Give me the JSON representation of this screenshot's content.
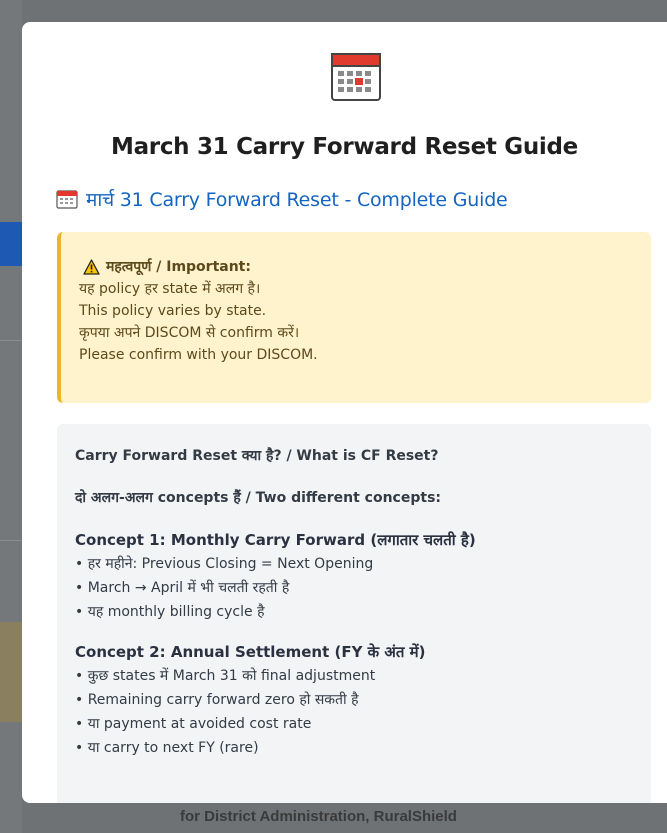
{
  "background": {
    "bottom_text": "for District Administration, RuralShield"
  },
  "modal": {
    "icon": "calendar-icon",
    "title": "March 31 Carry Forward Reset Guide",
    "guide_link": "मार्च 31 Carry Forward Reset - Complete Guide",
    "warning": {
      "icon": "warning-icon",
      "heading": "महत्वपूर्ण / Important:",
      "lines": [
        "यह policy हर state में अलग है।",
        "This policy varies by state.",
        "कृपया अपने DISCOM से confirm करें।",
        "Please confirm with your DISCOM."
      ]
    },
    "content": {
      "q1": "Carry Forward Reset क्या है? / What is CF Reset?",
      "q2": "दो अलग-अलग concepts हैं / Two different concepts:",
      "concept1": {
        "title": "Concept 1: Monthly Carry Forward (लगातार चलती है)",
        "bullets": [
          "• हर महीने: Previous Closing = Next Opening",
          "• March → April में भी चलती रहती है",
          "• यह monthly billing cycle है"
        ]
      },
      "concept2": {
        "title": "Concept 2: Annual Settlement (FY के अंत में)",
        "bullets": [
          "• कुछ states में March 31 को final adjustment",
          "• Remaining carry forward zero हो सकती है",
          "• या payment at avoided cost rate",
          "• या carry to next FY (rare)"
        ]
      }
    }
  },
  "colors": {
    "link": "#1565c0",
    "warning_bg": "#fff3cd",
    "warning_border": "#f0b429",
    "content_bg": "#f3f4f6"
  }
}
